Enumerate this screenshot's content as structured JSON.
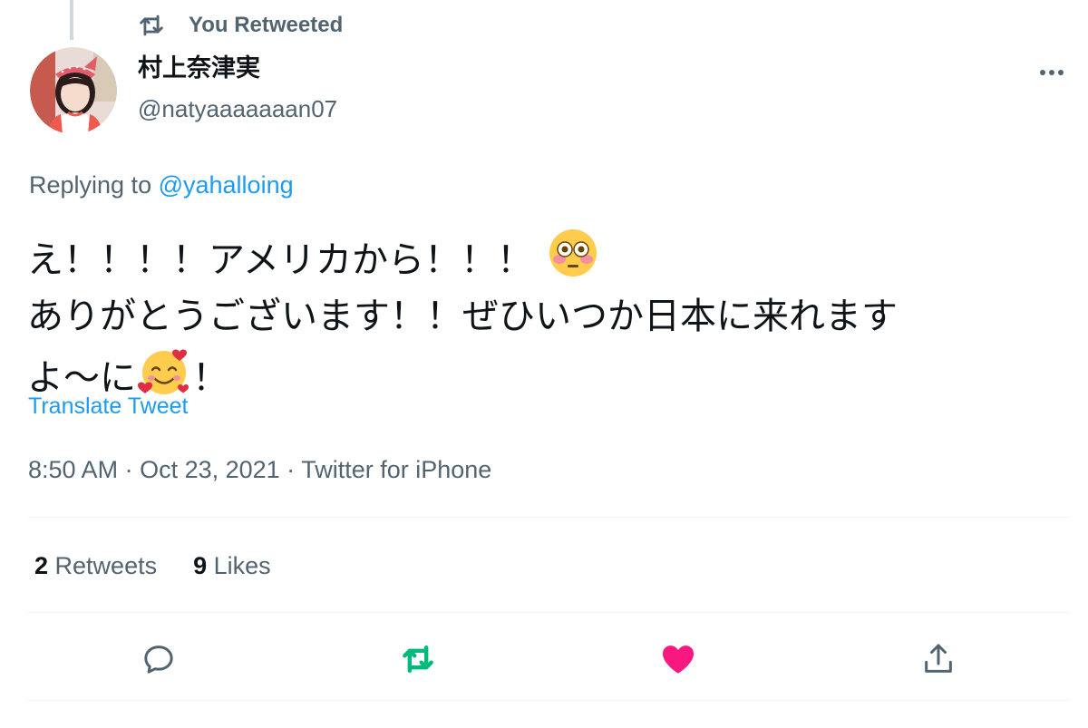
{
  "retweet_context": {
    "icon": "retweet-icon",
    "label": "You Retweeted"
  },
  "author": {
    "name": "村上奈津実",
    "handle": "@natyaaaaaaan07",
    "avatar": "profile-photo"
  },
  "reply": {
    "prefix": "Replying to ",
    "to_handle": "@yahalloing"
  },
  "tweet": {
    "line1_text": "え！！！！アメリカから！！！",
    "line1_emoji": "flushed-face-emoji",
    "line2_text": "ありがとうございます！！ぜひいつか日本に来れます",
    "line3_text_before": "よ〜に",
    "line3_emoji": "smiling-face-with-hearts-emoji",
    "line3_text_after": "！"
  },
  "translate_label": "Translate Tweet",
  "meta": {
    "time": "8:50 AM",
    "separator": " · ",
    "date": "Oct 23, 2021",
    "source": "Twitter for iPhone"
  },
  "stats": {
    "retweets_count": "2",
    "retweets_label": " Retweets",
    "likes_count": "9",
    "likes_label": " Likes"
  },
  "actions": {
    "reply_icon": "reply-icon",
    "retweet_icon": "retweet-icon",
    "retweet_active": true,
    "like_icon": "heart-icon",
    "like_active": true,
    "share_icon": "share-icon"
  },
  "colors": {
    "text_primary": "#0f1419",
    "text_secondary": "#536471",
    "link_blue": "#1d9bf0",
    "retweet_green": "#00ba7c",
    "like_pink": "#f91880",
    "divider": "#eff3f4"
  }
}
